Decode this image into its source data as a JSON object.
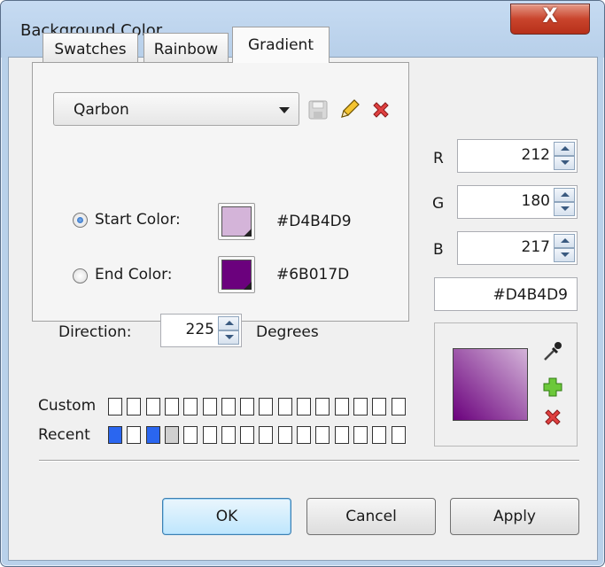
{
  "window": {
    "title": "Background Color...",
    "close_glyph": "X"
  },
  "tabs": [
    {
      "label": "Swatches",
      "active": false
    },
    {
      "label": "Rainbow",
      "active": false
    },
    {
      "label": "Gradient",
      "active": true
    }
  ],
  "gradient": {
    "preset_selected": "Qarbon",
    "start_label": "Start Color:",
    "start_hex": "#D4B4D9",
    "start_color": "#D4B4D9",
    "start_selected": true,
    "end_label": "End Color:",
    "end_hex": "#6B017D",
    "end_color": "#6B017D",
    "direction_label": "Direction:",
    "direction_value": "225",
    "direction_unit": "Degrees"
  },
  "rgb": {
    "r_label": "R",
    "r_value": "212",
    "g_label": "G",
    "g_value": "180",
    "b_label": "B",
    "b_value": "217",
    "hex_value": "#D4B4D9"
  },
  "palette": {
    "custom_label": "Custom",
    "recent_label": "Recent",
    "recent_colors": [
      "#2a66f0",
      "#ffffff",
      "#2a66f0",
      "#d0d0d0"
    ]
  },
  "buttons": {
    "ok": "OK",
    "cancel": "Cancel",
    "apply": "Apply"
  },
  "icons": {
    "save": "save-icon",
    "edit": "pencil-icon",
    "delete": "delete-icon",
    "eyedropper": "eyedropper-icon",
    "add": "add-icon",
    "remove": "remove-icon"
  }
}
